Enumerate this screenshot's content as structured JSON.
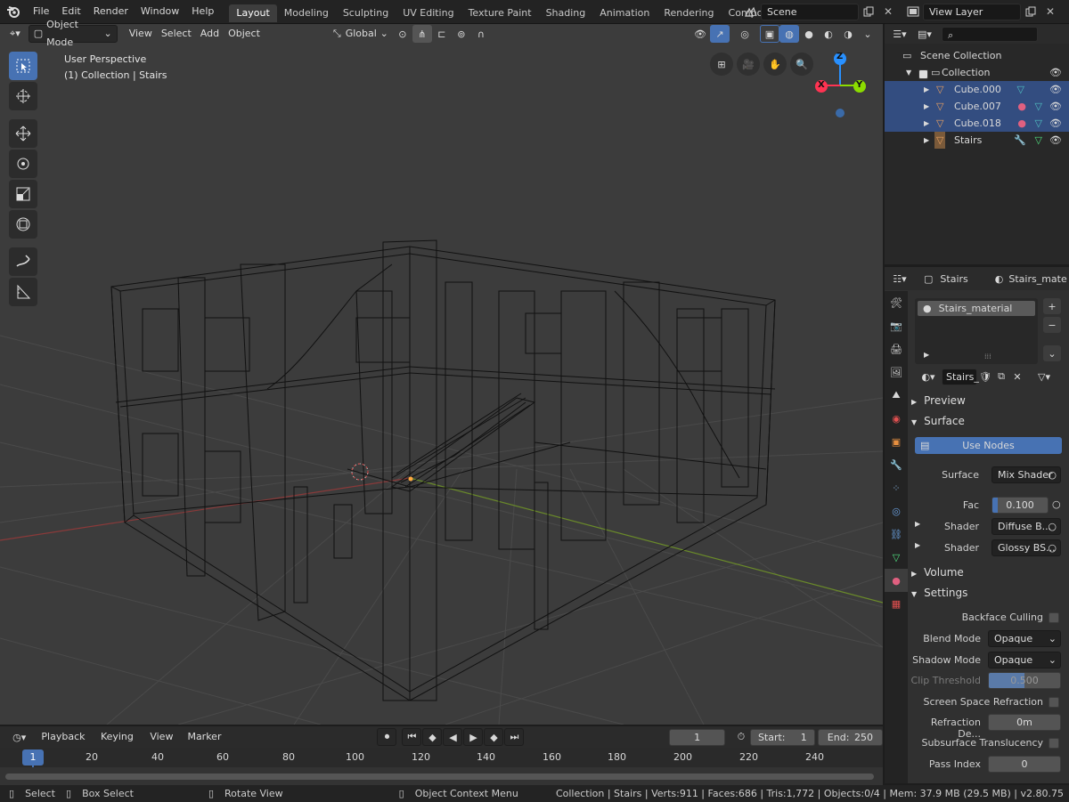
{
  "menu": [
    "File",
    "Edit",
    "Render",
    "Window",
    "Help"
  ],
  "workspaces": [
    "Layout",
    "Modeling",
    "Sculpting",
    "UV Editing",
    "Texture Paint",
    "Shading",
    "Animation",
    "Rendering",
    "Compositing"
  ],
  "active_workspace": "Layout",
  "scene": {
    "name": "Scene"
  },
  "view_layer": {
    "name": "View Layer"
  },
  "viewport": {
    "mode": "Object Mode",
    "menus": [
      "View",
      "Select",
      "Add",
      "Object"
    ],
    "orientation": "Global",
    "info_line1": "User Perspective",
    "info_line2": "(1) Collection | Stairs",
    "gizmo": {
      "z": "Z",
      "y": "Y",
      "x": "X"
    }
  },
  "outliner": {
    "root": "Scene Collection",
    "collection": "Collection",
    "items": [
      "Cube.000",
      "Cube.007",
      "Cube.018",
      "Stairs"
    ]
  },
  "properties": {
    "object_name": "Stairs",
    "material_tab": "Stairs_mate",
    "slot": "Stairs_material",
    "material_field": "Stairs_",
    "panels": {
      "preview": "Preview",
      "surface": "Surface",
      "volume": "Volume",
      "settings": "Settings"
    },
    "use_nodes": "Use Nodes",
    "surface_label": "Surface",
    "surface_value": "Mix Shader",
    "fac_label": "Fac",
    "fac_value": "0.100",
    "fac_fraction": 0.1,
    "shader1_label": "Shader",
    "shader1_value": "Diffuse B...",
    "shader2_label": "Shader",
    "shader2_value": "Glossy BS...",
    "backface_culling": "Backface Culling",
    "blend_mode_label": "Blend Mode",
    "blend_mode_value": "Opaque",
    "shadow_mode_label": "Shadow Mode",
    "shadow_mode_value": "Opaque",
    "clip_threshold_label": "Clip Threshold",
    "clip_threshold_value": "0.500",
    "clip_threshold_fraction": 0.5,
    "ssr_label": "Screen Space Refraction",
    "refraction_depth_label": "Refraction De...",
    "refraction_depth_value": "0m",
    "sss_label": "Subsurface Translucency",
    "pass_index_label": "Pass Index",
    "pass_index_value": "0"
  },
  "timeline": {
    "menus": [
      "Playback",
      "Keying",
      "View",
      "Marker"
    ],
    "current_frame": "1",
    "start_label": "Start:",
    "start_value": "1",
    "end_label": "End:",
    "end_value": "250",
    "ruler": [
      "1",
      "20",
      "40",
      "60",
      "80",
      "100",
      "120",
      "140",
      "160",
      "180",
      "200",
      "220",
      "240"
    ]
  },
  "statusbar": {
    "select": "Select",
    "box_select": "Box Select",
    "rotate_view": "Rotate View",
    "context_menu": "Object Context Menu",
    "stats": "Collection | Stairs | Verts:911 | Faces:686 | Tris:1,772 | Objects:0/4 | Mem: 37.9 MB (29.5 MB) | v2.80.75"
  },
  "colors": {
    "accent": "#4772b3",
    "selection": "#334d80",
    "axis_x": "#ff3352",
    "axis_y": "#8bdc00",
    "axis_z": "#2890ff"
  }
}
